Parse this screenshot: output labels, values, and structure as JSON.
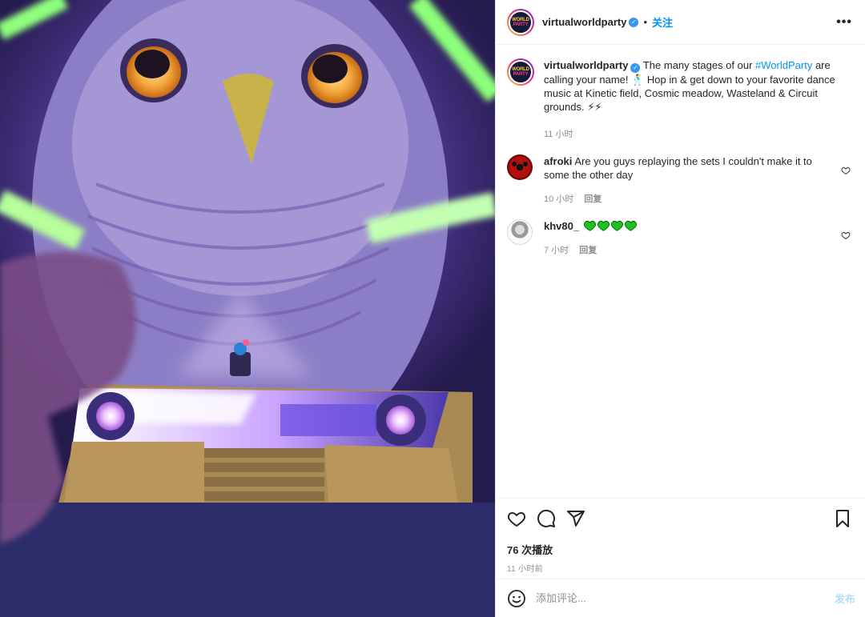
{
  "header": {
    "username": "virtualworldparty",
    "avatar_text_top": "WORLD",
    "avatar_text_bottom": "PARTY",
    "separator": "•",
    "follow_label": "关注",
    "more_icon": "more-horizontal-icon",
    "more_label": "•••"
  },
  "caption": {
    "username": "virtualworldparty",
    "text_before": "The many stages of our ",
    "hashtag": "#WorldParty",
    "text_after": " are calling your name! 🕺 Hop in & get down to your favorite dance music at Kinetic field, Cosmic meadow, Wasteland & Circuit grounds. ⚡⚡",
    "time": "11 小时"
  },
  "comments": [
    {
      "username": "afroki",
      "text": "Are you guys replaying the sets I couldn't make it to some the other day",
      "time": "10 小时",
      "reply_label": "回复"
    },
    {
      "username": "khv80_",
      "hearts": 4,
      "time": "7 小时",
      "reply_label": "回复"
    }
  ],
  "actions": {
    "like_icon": "heart-icon",
    "comment_icon": "comment-icon",
    "share_icon": "share-icon",
    "save_icon": "bookmark-icon",
    "views": "76 次播放",
    "posted": "11 小时前"
  },
  "add_comment": {
    "placeholder": "添加评论...",
    "post_label": "发布",
    "emoji_icon": "smiley-icon"
  },
  "colors": {
    "link_blue": "#0095f6",
    "verified_blue": "#3897f0",
    "hashtag": "#00376b",
    "muted": "#8e8e8e",
    "post_disabled": "#b2dffc",
    "heart_green": "#1ec21e"
  }
}
